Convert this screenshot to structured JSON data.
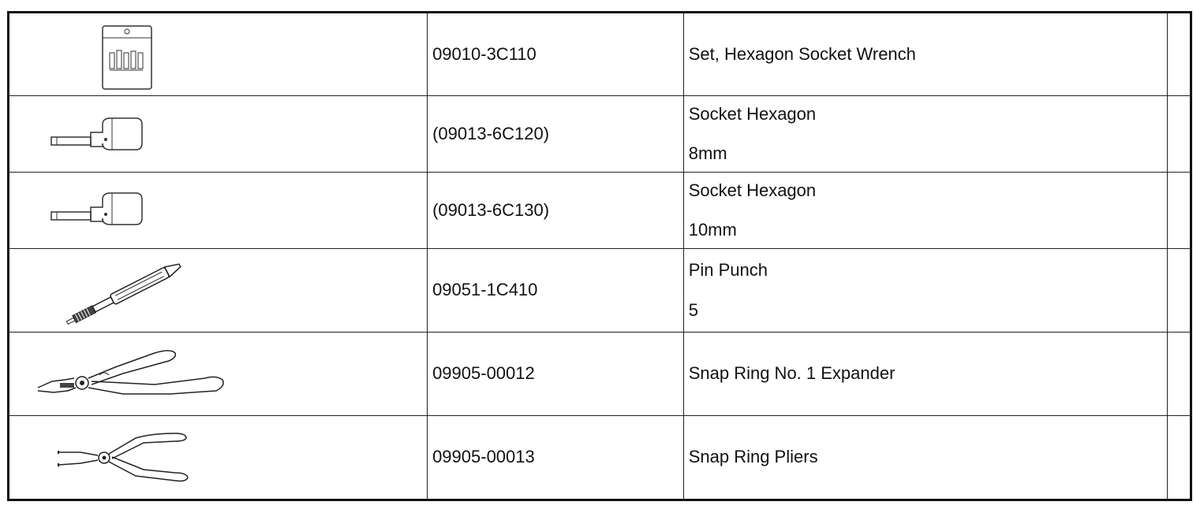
{
  "rows": [
    {
      "illustration": "hexagon-socket-wrench-set-icon",
      "part_number": "09010-3C110",
      "name_line1": "Set, Hexagon Socket Wrench",
      "name_line2": ""
    },
    {
      "illustration": "hexagon-socket-icon",
      "part_number": "(09013-6C120)",
      "name_line1": "Socket Hexagon",
      "name_line2": "8mm"
    },
    {
      "illustration": "hexagon-socket-icon",
      "part_number": "(09013-6C130)",
      "name_line1": "Socket Hexagon",
      "name_line2": "10mm"
    },
    {
      "illustration": "pin-punch-icon",
      "part_number": "09051-1C410",
      "name_line1": "Pin Punch",
      "name_line2": "5"
    },
    {
      "illustration": "snap-ring-expander-icon",
      "part_number": "09905-00012",
      "name_line1": "Snap Ring No. 1 Expander",
      "name_line2": ""
    },
    {
      "illustration": "snap-ring-pliers-icon",
      "part_number": "09905-00013",
      "name_line1": "Snap Ring Pliers",
      "name_line2": ""
    }
  ]
}
